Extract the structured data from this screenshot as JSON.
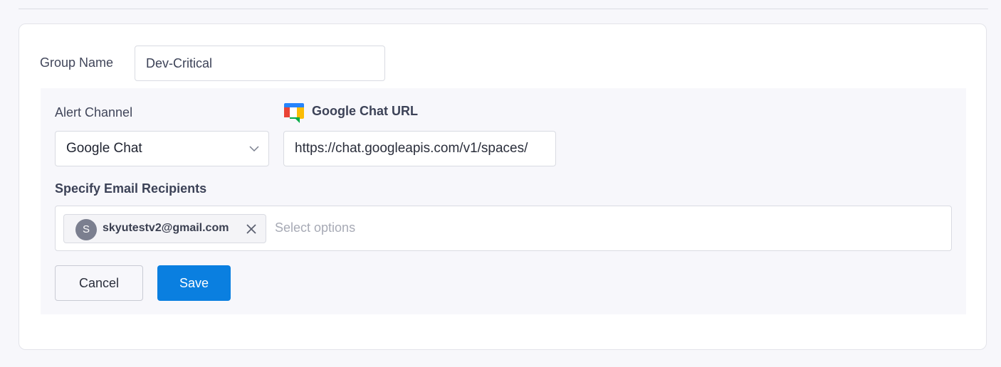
{
  "form": {
    "group_name_label": "Group Name",
    "group_name_value": "Dev-Critical",
    "alert_channel_label": "Alert Channel",
    "alert_channel_value": "Google Chat",
    "google_chat_url_label": "Google Chat URL",
    "google_chat_url_value": "https://chat.googleapis.com/v1/spaces/",
    "email_recipients_label": "Specify Email Recipients",
    "recipients": [
      {
        "avatar_letter": "S",
        "email": "skyutestv2@gmail.com"
      }
    ],
    "recipients_placeholder": "Select options"
  },
  "actions": {
    "cancel_label": "Cancel",
    "save_label": "Save"
  },
  "colors": {
    "accent": "#0a7fe0",
    "background": "#f7f7fb",
    "border": "#d9dbe2"
  },
  "icons": [
    "google-chat-icon",
    "chevron-down-icon",
    "close-icon"
  ]
}
